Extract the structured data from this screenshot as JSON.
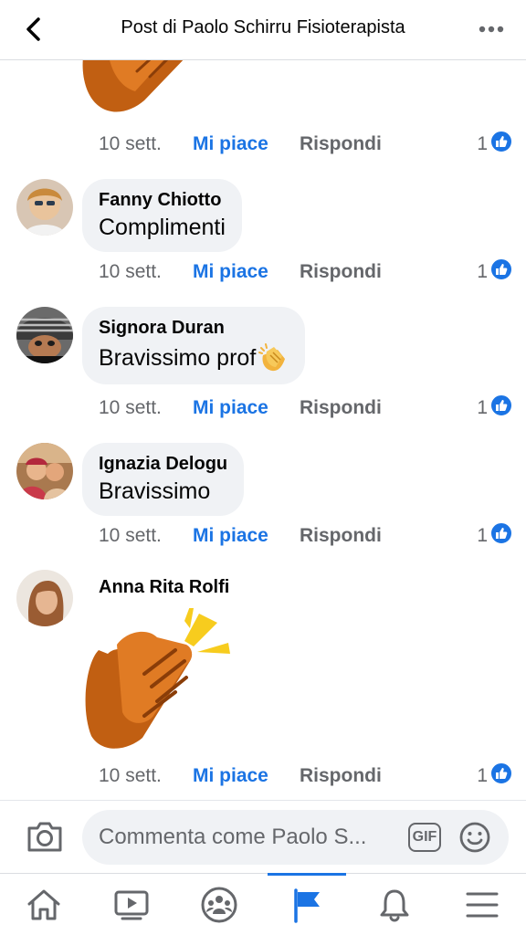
{
  "header": {
    "title": "Post di Paolo Schirru Fisioterapista",
    "back_icon": "chevron-left-icon",
    "more_icon": "more-horizontal-icon"
  },
  "actions": {
    "like_label": "Mi piace",
    "reply_label": "Rispondi"
  },
  "comments": [
    {
      "author": "",
      "text": "",
      "sticker": "clapping-hands-sticker",
      "time": "10 sett.",
      "likes": "1"
    },
    {
      "author": "Fanny Chiotto",
      "text": "Complimenti",
      "time": "10 sett.",
      "likes": "1"
    },
    {
      "author": "Signora Duran",
      "text": "Bravissimo prof",
      "emoji": "clapping-hands-emoji",
      "time": "10 sett.",
      "likes": "1"
    },
    {
      "author": "Ignazia Delogu",
      "text": "Bravissimo",
      "time": "10 sett.",
      "likes": "1"
    },
    {
      "author": "Anna Rita Rolfi",
      "text": "",
      "sticker": "clapping-hands-sticker",
      "time": "10 sett.",
      "likes": "1"
    }
  ],
  "composer": {
    "placeholder": "Commenta come Paolo S...",
    "gif_label": "GIF",
    "camera_icon": "camera-icon",
    "emoji_icon": "smiley-icon"
  },
  "tabbar": {
    "items": [
      {
        "name": "home",
        "icon": "home-icon"
      },
      {
        "name": "watch",
        "icon": "video-icon"
      },
      {
        "name": "groups",
        "icon": "groups-icon"
      },
      {
        "name": "pages",
        "icon": "flag-icon",
        "active": true
      },
      {
        "name": "notifications",
        "icon": "bell-icon"
      },
      {
        "name": "menu",
        "icon": "menu-icon"
      }
    ]
  },
  "colors": {
    "accent": "#1b74e4",
    "secondary_text": "#65676b",
    "bubble": "#f0f2f5"
  }
}
